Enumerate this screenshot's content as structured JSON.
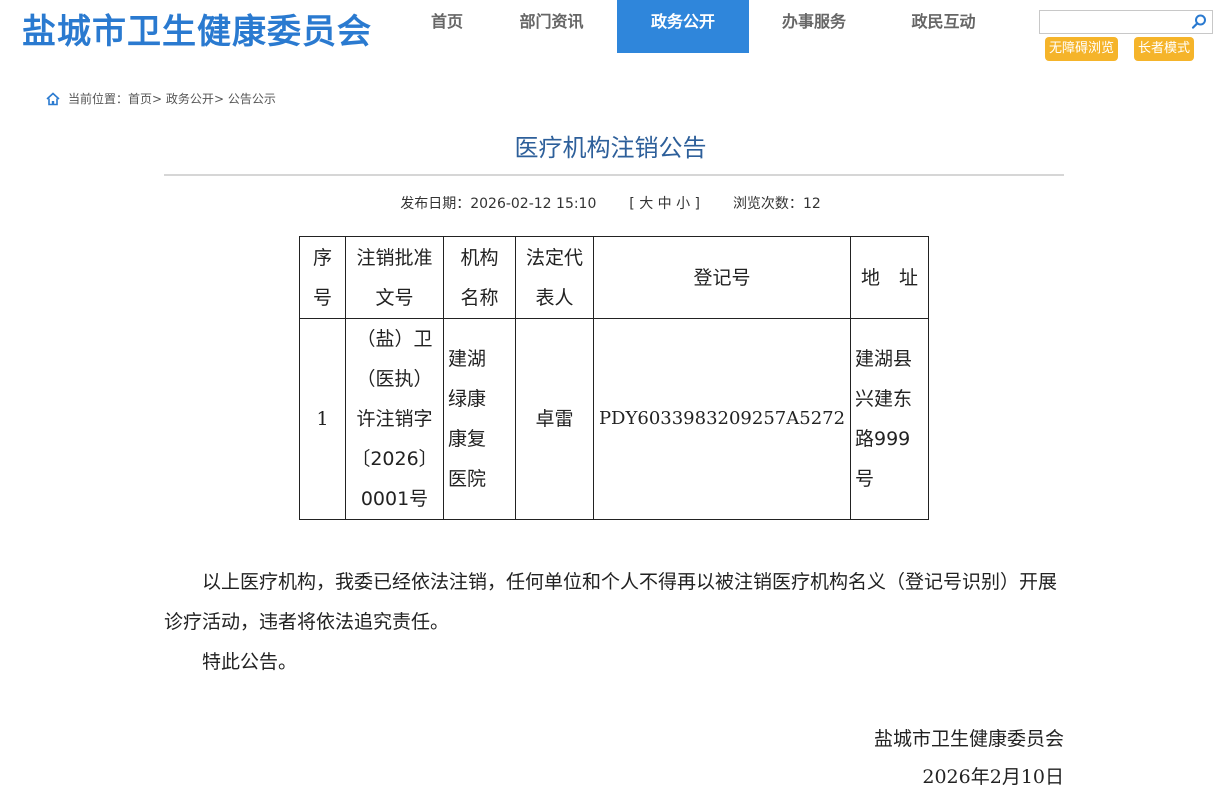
{
  "header": {
    "site_title": "盐城市卫生健康委员会",
    "nav": [
      {
        "label": "首页",
        "active": false
      },
      {
        "label": "部门资讯",
        "active": false
      },
      {
        "label": "政务公开",
        "active": true
      },
      {
        "label": "办事服务",
        "active": false
      },
      {
        "label": "政民互动",
        "active": false
      }
    ],
    "search": {
      "value": "",
      "placeholder": ""
    },
    "accessibility_label": "无障碍浏览",
    "elder_label": "长者模式",
    "colors": {
      "brand": "#2a7ad0",
      "nav_active": "#2f86db",
      "badge": "#f5b42a"
    }
  },
  "breadcrumb": {
    "prefix": "当前位置：",
    "items": [
      "首页",
      "政务公开",
      "公告公示"
    ],
    "separator": ">"
  },
  "article": {
    "title": "医疗机构注销公告",
    "publish_label": "发布日期：",
    "publish_date": "2026-02-12 15:10",
    "font_size_control": "[ 大 中 小 ]",
    "views_label": "浏览次数：",
    "views": "12"
  },
  "table": {
    "headers": [
      [
        "序",
        "号"
      ],
      [
        "注销批准",
        "文号"
      ],
      [
        "机构",
        "名称"
      ],
      [
        "法定代",
        "表人"
      ],
      [
        "登记号"
      ],
      [
        "地　址"
      ]
    ],
    "rows": [
      {
        "no": "1",
        "approval": [
          "（盐）卫",
          "（医执）",
          "许注销字",
          "〔2026〕",
          "0001号"
        ],
        "name": [
          "建湖",
          "绿康",
          "康复",
          "医院"
        ],
        "representative": "卓雷",
        "reg_no": "PDY6033983209257A5272",
        "address": [
          "建湖县",
          "兴建东",
          "路999",
          "号"
        ]
      }
    ]
  },
  "body": {
    "paragraph1": "以上医疗机构，我委已经依法注销，任何单位和个人不得再以被注销医疗机构名义（登记号识别）开展诊疗活动，违者将依法追究责任。",
    "paragraph2": "特此公告。"
  },
  "signature": {
    "org": "盐城市卫生健康委员会",
    "date": "2026年2月10日"
  }
}
